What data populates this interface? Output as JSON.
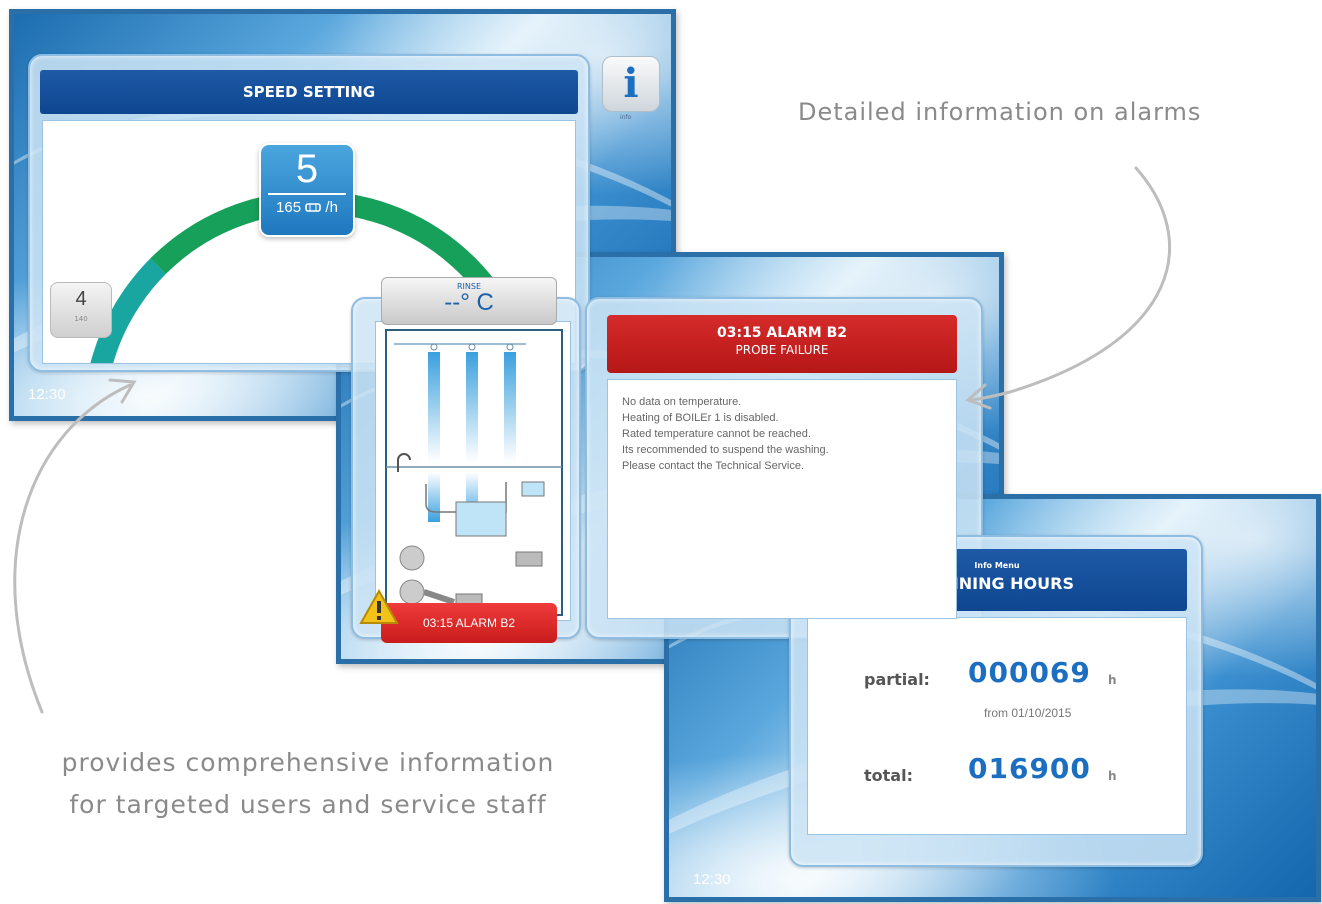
{
  "speed_screen": {
    "title": "SPEED SETTING",
    "current_speed": "5",
    "current_rate": "165",
    "rate_unit": "/h",
    "prev_speed": "4",
    "prev_rate": "140",
    "info_button_label": "i",
    "info_caption": "info",
    "clock": "12:30",
    "icons": [
      "basket-icon",
      "info-icon"
    ]
  },
  "alarm_screen": {
    "rinse_label": "RINSE",
    "rinse_temp": "--° C",
    "alarm_title": "03:15 ALARM B2",
    "alarm_subtitle": "PROBE FAILURE",
    "alarm_lines": [
      "No data on temperature.",
      "Heating of BOILEr 1 is disabled.",
      "Rated temperature cannot be reached.",
      "Its recommended to suspend the washing.",
      "Please contact the Technical Service."
    ],
    "alarm_badge": "03:15 ALARM B2",
    "icons": [
      "warning-icon",
      "machine-diagram-icon"
    ]
  },
  "hours_screen": {
    "menu_label": "Info Menu",
    "title": "RUNNING HOURS",
    "partial_label": "partial:",
    "partial_value": "000069",
    "unit": "h",
    "from_text": "from 01/10/2015",
    "total_label": "total:",
    "total_value": "016900",
    "clock": "12:30"
  },
  "annotations": {
    "alarms": "Detailed information on alarms",
    "info_line1": "provides comprehensive information",
    "info_line2": "for targeted users and service staff"
  },
  "colors": {
    "frame_blue": "#2a6fa8",
    "title_blue": "#0e4690",
    "alarm_red": "#c91c1c",
    "value_blue": "#1c6fc0",
    "arc_green": "#17a05a"
  }
}
